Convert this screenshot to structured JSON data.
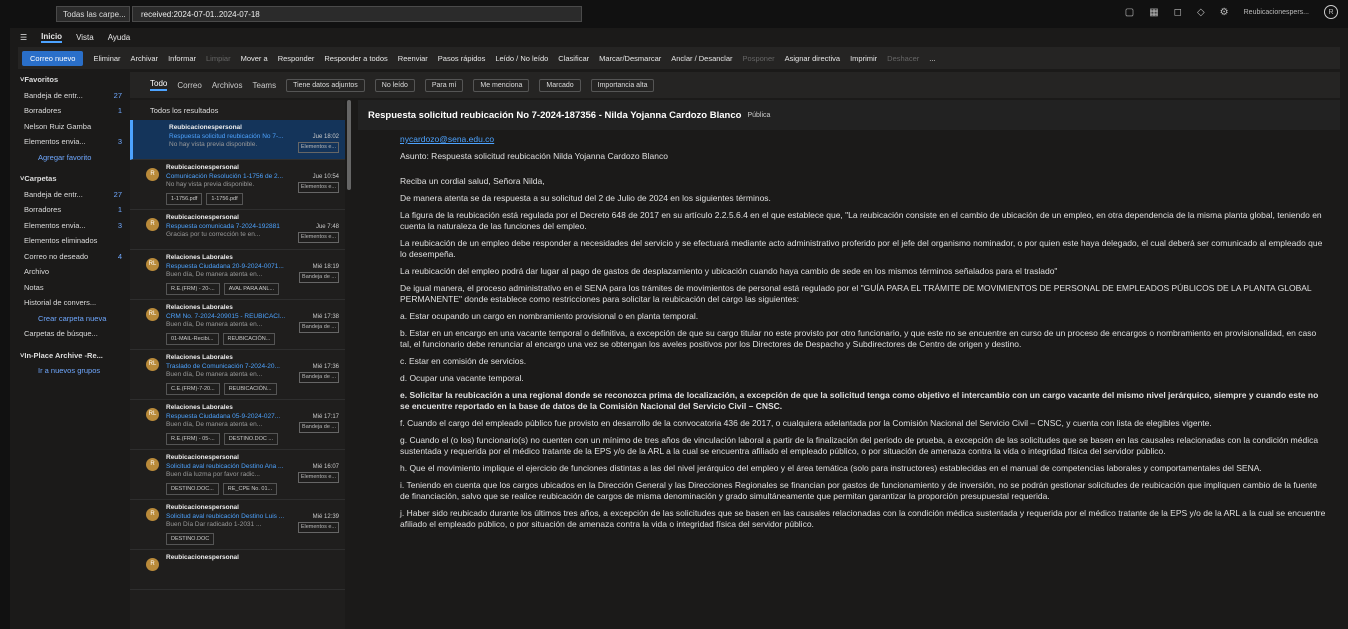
{
  "scope": "Todas las carpe...",
  "search": "received:2024-07-01..2024-07-18",
  "account": "Reubicacionespers...",
  "ribbon_tabs": [
    "Inicio",
    "Vista",
    "Ayuda"
  ],
  "ribbon": {
    "new": "Correo nuevo",
    "items": [
      "Eliminar",
      "Archivar",
      "Informar",
      "Limpiar",
      "Mover a",
      "Responder",
      "Responder a todos",
      "Reenviar",
      "Pasos rápidos",
      "Leído / No leído",
      "Clasificar",
      "Marcar/Desmarcar",
      "Anclar / Desanclar",
      "Posponer",
      "Asignar directiva",
      "Imprimir",
      "Deshacer",
      "..."
    ]
  },
  "folders": [
    {
      "label": "Favoritos",
      "sec": true
    },
    {
      "label": "Bandeja de entr...",
      "count": "27"
    },
    {
      "label": "Borradores",
      "count": "1"
    },
    {
      "label": "Nelson Ruiz Gamba"
    },
    {
      "label": "Elementos envia...",
      "count": "3"
    },
    {
      "label": "Agregar favorito",
      "link": true
    },
    {
      "label": "Carpetas",
      "sec": true
    },
    {
      "label": "Bandeja de entr...",
      "count": "27"
    },
    {
      "label": "Borradores",
      "count": "1"
    },
    {
      "label": "Elementos envia...",
      "count": "3"
    },
    {
      "label": "Elementos eliminados"
    },
    {
      "label": "Correo no deseado",
      "count": "4"
    },
    {
      "label": "Archivo"
    },
    {
      "label": "Notas"
    },
    {
      "label": "Historial de convers..."
    },
    {
      "label": "Crear carpeta nueva",
      "link": true
    },
    {
      "label": "Carpetas de búsque..."
    },
    {
      "label": "In-Place Archive -Re...",
      "sec": true
    },
    {
      "label": "Ir a nuevos grupos",
      "link": true
    }
  ],
  "filters": {
    "tabs": [
      "Todo",
      "Correo",
      "Archivos",
      "Teams"
    ],
    "chips": [
      "Tiene datos adjuntos",
      "No leído",
      "Para mí",
      "Me menciona",
      "Marcado",
      "Importancia alta"
    ]
  },
  "list_header": "Todos los resultados",
  "messages": [
    {
      "av": "",
      "sender": "Reubicacionespersonal",
      "subj": "Respuesta solicitud reubicación No 7-...",
      "prev": "No hay vista previa disponible.",
      "date": "Jue 18:02",
      "tag": "Elementos e...",
      "atts": [],
      "sel": true
    },
    {
      "av": "R",
      "sender": "Reubicacionespersonal",
      "subj": "Comunicación Resolución 1-1756 de 2...",
      "prev": "No hay vista previa disponible.",
      "date": "Jue 10:54",
      "tag": "Elementos e...",
      "atts": [
        "1-1756.pdf",
        "1-1756.pdf"
      ]
    },
    {
      "av": "R",
      "sender": "Reubicacionespersonal",
      "subj": "Respuesta comunicada 7-2024-192881",
      "prev": "Gracias por tu corrección te en...",
      "date": "Jue 7:48",
      "tag": "Elementos e...",
      "atts": []
    },
    {
      "av": "RL",
      "sender": "Relaciones Laborales",
      "subj": "Respuesta Ciudadana 20-9-2024-0071...",
      "prev": "Buen día, De manera atenta en...",
      "date": "Mié 18:19",
      "tag": "Bandeja de ...",
      "atts": [
        "R.E.(FRM) - 20-...",
        "AVAL PARA ANL..."
      ]
    },
    {
      "av": "RL",
      "sender": "Relaciones Laborales",
      "subj": "CRM No. 7-2024-209015 - REUBICACI...",
      "prev": "Buen día, De manera atenta en...",
      "date": "Mié 17:38",
      "tag": "Bandeja de ...",
      "atts": [
        "01-MAIL-Recibi...",
        "REUBICACIÓN..."
      ]
    },
    {
      "av": "RL",
      "sender": "Relaciones Laborales",
      "subj": "Traslado de Comunicación 7-2024-20...",
      "prev": "Buen día, De manera atenta en...",
      "date": "Mié 17:36",
      "tag": "Bandeja de ...",
      "atts": [
        "C.E.(FRM)-7-20...",
        "REUBICACIÓN..."
      ]
    },
    {
      "av": "RL",
      "sender": "Relaciones Laborales",
      "subj": "Respuesta Ciudadana 05-9-2024-027...",
      "prev": "Buen día, De manera atenta en...",
      "date": "Mié 17:17",
      "tag": "Bandeja de ...",
      "atts": [
        "R.E.(FRM) - 05-...",
        "DESTINO.DOC ..."
      ]
    },
    {
      "av": "R",
      "sender": "Reubicacionespersonal",
      "subj": "Solicitud aval reubicación Destino Ana ...",
      "prev": "Buen día luzma por favor radic...",
      "date": "Mié 16:07",
      "tag": "Elementos e...",
      "atts": [
        "DESTINO.DOC...",
        "RE_CPE No. 01..."
      ]
    },
    {
      "av": "R",
      "sender": "Reubicacionespersonal",
      "subj": "Solicitud aval reubicación Destino Luis ...",
      "prev": "Buen Día Dar radicado 1-2031 ...",
      "date": "Mié 12:39",
      "tag": "Elementos e...",
      "atts": [
        "DESTINO.DOC"
      ]
    },
    {
      "av": "R",
      "sender": "Reubicacionespersonal",
      "subj": "",
      "prev": "",
      "date": "",
      "tag": "",
      "atts": []
    }
  ],
  "reading": {
    "subject": "Respuesta solicitud reubicación  No 7-2024-187356 - Nilda Yojanna Cardozo Blanco",
    "visibility": "Pública",
    "email": "nycardozo@sena.edu.co",
    "asunto": "Asunto: Respuesta solicitud reubicación Nilda Yojanna Cardozo Blanco",
    "paras": [
      {
        "t": "Reciba un cordial salud, Señora Nilda,"
      },
      {
        "t": "De manera atenta se da respuesta a su solicitud del 2 de Julio de 2024 en los siguientes términos."
      },
      {
        "t": "La figura de la reubicación está regulada por el Decreto 648 de 2017 en su artículo 2.2.5.6.4 en el que establece que, \"La reubicación consiste en el cambio de ubicación de un empleo, en otra dependencia de la misma planta global, teniendo en cuenta la naturaleza de las funciones del empleo."
      },
      {
        "t": "La reubicación de un empleo debe responder a necesidades del servicio y se efectuará mediante acto administrativo proferido por el jefe del organismo nominador, o por quien este haya delegado, el cual deberá ser comunicado al empleado que lo desempeña."
      },
      {
        "t": "La reubicación del empleo podrá dar lugar al pago de gastos de desplazamiento y ubicación cuando haya cambio de sede en los mismos términos señalados para el traslado\""
      },
      {
        "t": "De igual manera, el proceso administrativo en el SENA para los trámites de movimientos de personal está regulado por el \"GUÍA PARA EL TRÁMITE DE MOVIMIENTOS DE PERSONAL DE EMPLEADOS PÚBLICOS DE LA PLANTA GLOBAL PERMANENTE\" donde establece como restricciones para solicitar la reubicación del cargo las siguientes:"
      },
      {
        "t": "a. Estar ocupando un cargo en nombramiento provisional o en planta temporal."
      },
      {
        "t": "b. Estar en un encargo en una vacante temporal o definitiva, a excepción de que su cargo titular no este provisto por otro funcionario, y que este no se encuentre en curso de un proceso de encargos o nombramiento en provisionalidad, en caso tal, el funcionario debe renunciar al encargo una vez se obtengan los aveles positivos por los Directores de Despacho y Subdirectores de Centro de origen y destino."
      },
      {
        "t": "c. Estar en comisión de servicios."
      },
      {
        "t": "d. Ocupar una vacante temporal."
      },
      {
        "t": "e. Solicitar la reubicación a una regional donde se reconozca prima de localización, a excepción de que la solicitud tenga como objetivo el intercambio con un cargo vacante del mismo nivel jerárquico, siempre y cuando este no se encuentre reportado en la base de datos de la Comisión Nacional del Servicio Civil – CNSC.",
        "b": true
      },
      {
        "t": "f. Cuando el cargo del empleado público fue provisto en desarrollo de la convocatoria 436 de 2017, o cualquiera adelantada por la Comisión Nacional del Servicio Civil – CNSC, y cuenta con lista de elegibles vigente."
      },
      {
        "t": "g. Cuando el (o los) funcionario(s) no cuenten con un mínimo de tres años de vinculación laboral a partir de la finalización del periodo de prueba, a excepción de las solicitudes que se basen en las causales relacionadas con la condición médica sustentada y requerida por el médico tratante de la EPS y/o de la ARL a la cual se encuentra afiliado el empleado público, o por situación de amenaza contra la vida o integridad física del servidor público."
      },
      {
        "t": "h. Que el movimiento implique el ejercicio de funciones distintas a las del nivel jerárquico del empleo y el área temática (solo para instructores) establecidas en el manual de competencias laborales y comportamentales del SENA."
      },
      {
        "t": "i. Teniendo en cuenta que los cargos ubicados en la Dirección General y las Direcciones Regionales se financian por gastos de funcionamiento y de inversión, no se podrán gestionar solicitudes de reubicación que impliquen cambio de la fuente de financiación, salvo que se realice reubicación de cargos de misma denominación y grado simultáneamente que permitan garantizar la proporción presupuestal requerida."
      },
      {
        "t": "j. Haber sido reubicado durante los últimos tres años, a excepción de las solicitudes que se basen en las causales relacionadas con la condición médica sustentada y requerida por el médico tratante de la EPS y/o de la ARL a la cual se encuentre afiliado el empleado público, o por situación de amenaza contra la vida o integridad física del servidor público."
      }
    ]
  }
}
